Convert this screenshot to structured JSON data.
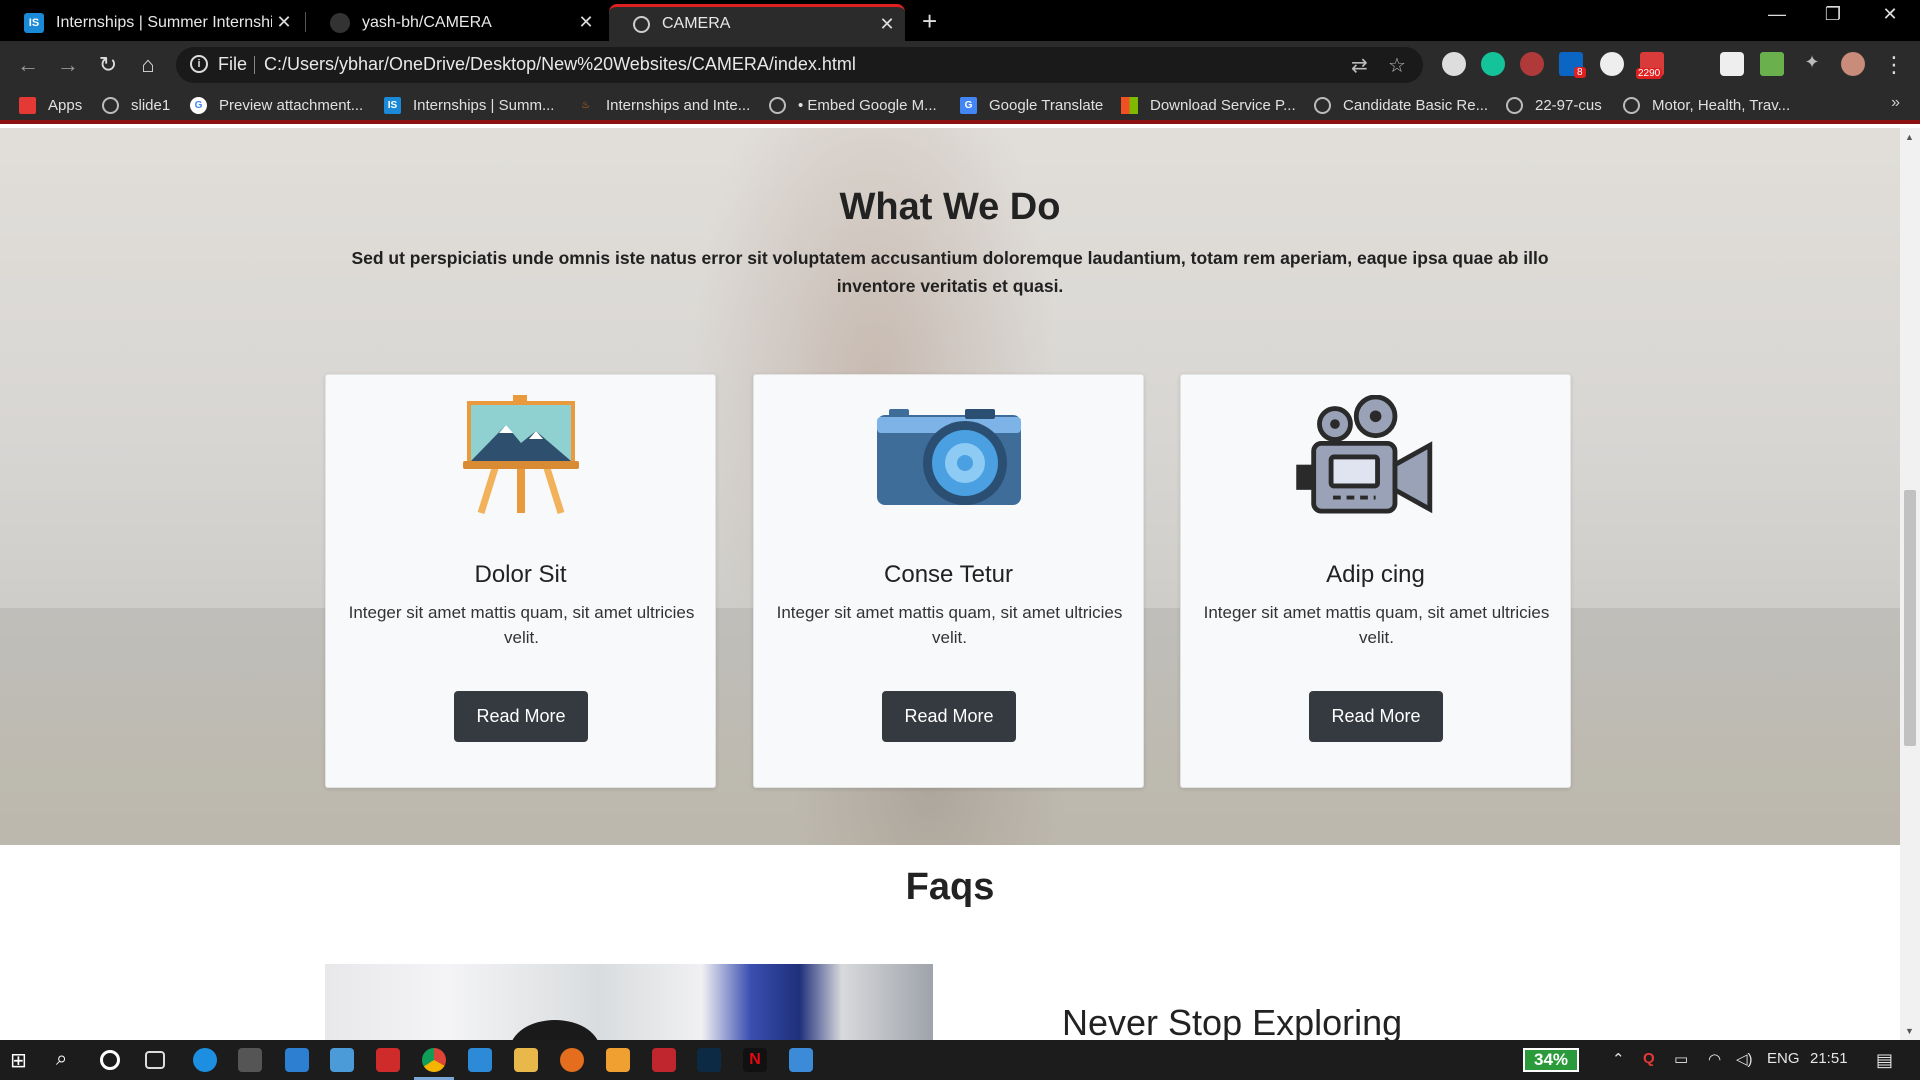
{
  "browser": {
    "tabs": [
      {
        "title": "Internships | Summer Internship",
        "favicon": "internshala-icon",
        "active": false
      },
      {
        "title": "yash-bh/CAMERA",
        "favicon": "github-icon",
        "active": false
      },
      {
        "title": "CAMERA",
        "favicon": "globe-icon",
        "active": true
      }
    ],
    "omnibox": {
      "scheme_label": "File",
      "url": "C:/Users/ybhar/OneDrive/Desktop/New%20Websites/CAMERA/index.html"
    },
    "extension_badges": {
      "linkedin": "8",
      "mail": "2290"
    },
    "bookmarks": [
      {
        "label": "Apps",
        "icon": "apps-grid-icon"
      },
      {
        "label": "slide1",
        "icon": "globe-icon"
      },
      {
        "label": "Preview attachment...",
        "icon": "google-icon"
      },
      {
        "label": "Internships | Summ...",
        "icon": "internshala-icon"
      },
      {
        "label": "Internships and Inte...",
        "icon": "flame-icon"
      },
      {
        "label": "• Embed Google M...",
        "icon": "globe-icon"
      },
      {
        "label": "Google Translate",
        "icon": "translate-icon"
      },
      {
        "label": "Download Service P...",
        "icon": "microsoft-icon"
      },
      {
        "label": "Candidate Basic Re...",
        "icon": "globe-icon"
      },
      {
        "label": "22-97-cus",
        "icon": "globe-icon"
      },
      {
        "label": "Motor, Health, Trav...",
        "icon": "globe-icon"
      }
    ],
    "bookmarks_overflow": "»"
  },
  "page": {
    "what_we_do": {
      "title": "What We Do",
      "description": "Sed ut perspiciatis unde omnis iste natus error sit voluptatem accusantium doloremque laudantium, totam rem aperiam, eaque ipsa quae ab illo inventore veritatis et quasi.",
      "cards": [
        {
          "icon": "easel-painting-icon",
          "title": "Dolor Sit",
          "text": "Integer sit amet mattis quam, sit amet ultricies velit.",
          "button": "Read More"
        },
        {
          "icon": "camera-icon",
          "title": "Conse Tetur",
          "text": "Integer sit amet mattis quam, sit amet ultricies velit.",
          "button": "Read More"
        },
        {
          "icon": "movie-camera-icon",
          "title": "Adip cing",
          "text": "Integer sit amet mattis quam, sit amet ultricies velit.",
          "button": "Read More"
        }
      ]
    },
    "faqs": {
      "title": "Faqs",
      "subtitle": "Never Stop Exploring"
    }
  },
  "taskbar": {
    "battery": "34%",
    "language": "ENG",
    "time": "21:51"
  },
  "colors": {
    "button_bg": "#343a40",
    "card_bg": "#f8f9fa",
    "active_tab_accent": "#e02020",
    "battery_green": "#2a9a3a"
  }
}
